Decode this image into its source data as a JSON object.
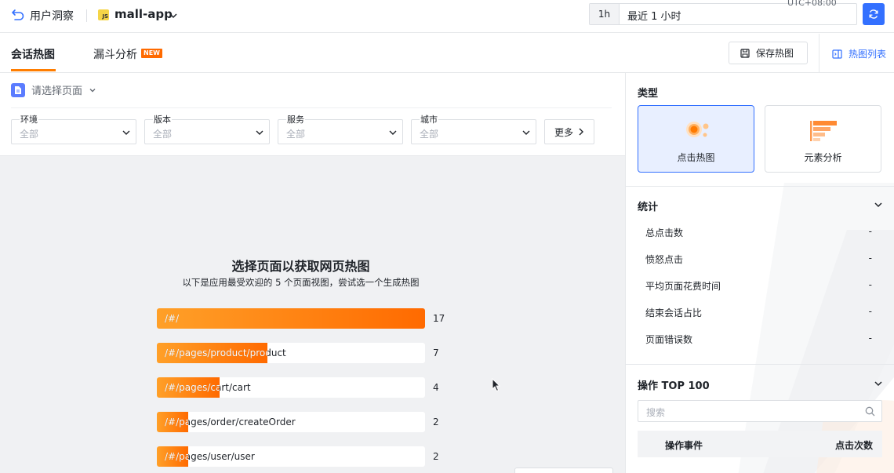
{
  "header": {
    "app_name": "用户洞察",
    "project_badge": "JS",
    "project_name": "mall-app",
    "time_short": "1h",
    "time_range": "最近 1 小时",
    "timezone": "UTC+08:00"
  },
  "tabs": {
    "items": [
      {
        "label": "会话热图",
        "active": true
      },
      {
        "label": "漏斗分析",
        "badge": "NEW"
      }
    ],
    "save_label": "保存热图",
    "list_label": "热图列表"
  },
  "filters": {
    "page_select": "请选择页面",
    "items": [
      {
        "label": "环境",
        "value": "全部"
      },
      {
        "label": "版本",
        "value": "全部"
      },
      {
        "label": "服务",
        "value": "全部"
      },
      {
        "label": "城市",
        "value": "全部"
      }
    ],
    "more_label": "更多"
  },
  "main": {
    "title": "选择页面以获取网页热图",
    "subtitle": "以下是应用最受欢迎的 5 个页面视图，尝试选一个生成热图",
    "bars": [
      {
        "label": "/#/",
        "count": 17,
        "fill": 1.0
      },
      {
        "label": "/#/pages/product/product",
        "count": 7,
        "fill": 0.412
      },
      {
        "label": "/#/pages/cart/cart",
        "count": 4,
        "fill": 0.235
      },
      {
        "label": "/#/pages/order/createOrder",
        "count": 2,
        "fill": 0.118
      },
      {
        "label": "/#/pages/user/user",
        "count": 2,
        "fill": 0.118
      }
    ]
  },
  "right_panel": {
    "type_title": "类型",
    "types": [
      {
        "label": "点击热图",
        "active": true,
        "icon": "click-heatmap-icon"
      },
      {
        "label": "元素分析",
        "active": false,
        "icon": "element-analysis-icon"
      }
    ],
    "stats_title": "统计",
    "stats": [
      {
        "label": "总点击数",
        "value": "-"
      },
      {
        "label": "愤怒点击",
        "value": "-"
      },
      {
        "label": "平均页面花费时间",
        "value": "-"
      },
      {
        "label": "结束会话占比",
        "value": "-"
      },
      {
        "label": "页面错误数",
        "value": "-"
      }
    ],
    "ops_title": "操作 TOP 100",
    "search_placeholder": "搜索",
    "table_headers": [
      "操作事件",
      "点击次数"
    ]
  },
  "colors": {
    "accent": "#3370ff",
    "bar_start": "#ffa028",
    "bar_end": "#ff6a00"
  }
}
